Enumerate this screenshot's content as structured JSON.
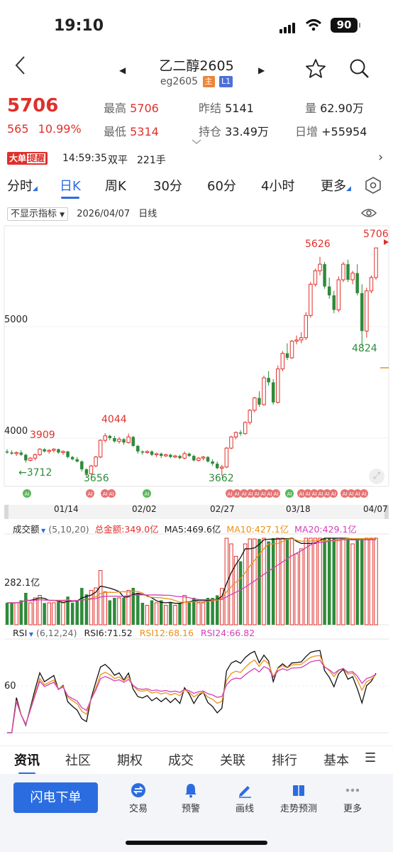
{
  "status": {
    "time": "19:10",
    "battery": "90"
  },
  "header": {
    "title": "乙二醇2605",
    "code": "eg2605",
    "badge_main": "主",
    "badge_l1": "L1"
  },
  "quote": {
    "last": "5706",
    "change": "565",
    "change_pct": "10.99%",
    "high_label": "最高",
    "high": "5706",
    "low_label": "最低",
    "low": "5314",
    "prev_settle_label": "昨结",
    "prev_settle": "5141",
    "open_interest_label": "持仓",
    "open_interest": "33.49万",
    "volume_label": "量",
    "volume": "62.90万",
    "daily_inc_label": "日增",
    "daily_inc": "+55954"
  },
  "banner": {
    "tag_a": "大单",
    "tag_b": "提醒",
    "time": "14:59:35",
    "type": "双平",
    "qty": "221手",
    "arrow": "›"
  },
  "tabs": [
    "分时",
    "日K",
    "周K",
    "30分",
    "60分",
    "4小时",
    "更多"
  ],
  "indicator_row": {
    "dropdown": "不显示指标",
    "date": "2026/04/07",
    "period": "日线"
  },
  "main_chart": {
    "y_labels": [
      "5000",
      "4000"
    ],
    "x_labels": [
      "01/14",
      "02/02",
      "02/27",
      "03/18",
      "04/07"
    ],
    "annotations": [
      "5706",
      "5626",
      "4824",
      "4044",
      "3909",
      "←3712",
      "3656",
      "3662"
    ],
    "ai_badge": "AI"
  },
  "volume_panel": {
    "dropdown": "成交额",
    "params": "(5,10,20)",
    "total": "总金额:349.0亿",
    "ma5": "MA5:469.6亿",
    "ma10": "MA10:427.1亿",
    "ma20": "MA20:429.1亿",
    "y_label": "282.1亿"
  },
  "rsi_panel": {
    "dropdown": "RSI",
    "params": "(6,12,24)",
    "rsi6": "RSI6:71.52",
    "rsi12": "RSI12:68.16",
    "rsi24": "RSI24:66.82",
    "y_label": "60"
  },
  "bottom_tabs": [
    "资讯",
    "社区",
    "期权",
    "成交",
    "关联",
    "排行",
    "基本",
    "☰"
  ],
  "actions": {
    "flash": "闪电下单",
    "items": [
      "交易",
      "预警",
      "画线",
      "走势预测",
      "更多"
    ]
  },
  "chart_data": {
    "type": "candlestick",
    "title": "",
    "x_ticks": [
      "01/14",
      "02/02",
      "02/27",
      "03/18",
      "04/07"
    ],
    "y_ticks": [
      4000,
      5000
    ],
    "candles_ohlc": [
      [
        3880,
        3900,
        3860,
        3870
      ],
      [
        3870,
        3890,
        3850,
        3860
      ],
      [
        3860,
        3880,
        3840,
        3870
      ],
      [
        3870,
        3890,
        3840,
        3850
      ],
      [
        3850,
        3860,
        3780,
        3800
      ],
      [
        3800,
        3830,
        3790,
        3820
      ],
      [
        3820,
        3860,
        3800,
        3850
      ],
      [
        3850,
        3910,
        3840,
        3900
      ],
      [
        3900,
        3909,
        3870,
        3880
      ],
      [
        3880,
        3900,
        3860,
        3890
      ],
      [
        3890,
        3910,
        3870,
        3900
      ],
      [
        3900,
        3905,
        3860,
        3870
      ],
      [
        3870,
        3890,
        3850,
        3880
      ],
      [
        3880,
        3885,
        3820,
        3830
      ],
      [
        3830,
        3840,
        3800,
        3810
      ],
      [
        3810,
        3830,
        3780,
        3790
      ],
      [
        3790,
        3800,
        3700,
        3720
      ],
      [
        3720,
        3730,
        3656,
        3680
      ],
      [
        3680,
        3760,
        3670,
        3750
      ],
      [
        3750,
        3840,
        3740,
        3830
      ],
      [
        3830,
        3990,
        3820,
        3980
      ],
      [
        3980,
        4044,
        3960,
        4020
      ],
      [
        4020,
        4030,
        3980,
        4000
      ],
      [
        4000,
        4020,
        3960,
        3970
      ],
      [
        3970,
        4010,
        3950,
        3990
      ],
      [
        3990,
        4000,
        3940,
        3960
      ],
      [
        3960,
        4040,
        3950,
        4010
      ],
      [
        4010,
        4020,
        3920,
        3930
      ],
      [
        3930,
        3940,
        3860,
        3880
      ],
      [
        3880,
        3890,
        3850,
        3870
      ],
      [
        3870,
        3890,
        3860,
        3880
      ],
      [
        3880,
        3890,
        3840,
        3850
      ],
      [
        3850,
        3870,
        3830,
        3860
      ],
      [
        3860,
        3870,
        3820,
        3840
      ],
      [
        3840,
        3860,
        3830,
        3850
      ],
      [
        3850,
        3860,
        3820,
        3830
      ],
      [
        3830,
        3850,
        3820,
        3840
      ],
      [
        3840,
        3850,
        3810,
        3820
      ],
      [
        3820,
        3880,
        3810,
        3860
      ],
      [
        3860,
        3870,
        3830,
        3840
      ],
      [
        3840,
        3850,
        3790,
        3800
      ],
      [
        3800,
        3830,
        3790,
        3820
      ],
      [
        3820,
        3840,
        3800,
        3830
      ],
      [
        3830,
        3840,
        3780,
        3790
      ],
      [
        3790,
        3810,
        3750,
        3770
      ],
      [
        3770,
        3790,
        3720,
        3730
      ],
      [
        3730,
        3760,
        3662,
        3740
      ],
      [
        3740,
        3920,
        3730,
        3910
      ],
      [
        3910,
        4020,
        3900,
        4010
      ],
      [
        4010,
        4060,
        3990,
        4050
      ],
      [
        4050,
        4070,
        4020,
        4040
      ],
      [
        4040,
        4150,
        4030,
        4140
      ],
      [
        4140,
        4260,
        4120,
        4250
      ],
      [
        4250,
        4370,
        4230,
        4360
      ],
      [
        4360,
        4420,
        4280,
        4300
      ],
      [
        4300,
        4560,
        4290,
        4540
      ],
      [
        4540,
        4600,
        4470,
        4500
      ],
      [
        4500,
        4530,
        4300,
        4320
      ],
      [
        4320,
        4650,
        4310,
        4620
      ],
      [
        4620,
        4780,
        4600,
        4760
      ],
      [
        4760,
        4850,
        4700,
        4720
      ],
      [
        4720,
        4880,
        4710,
        4870
      ],
      [
        4870,
        4920,
        4840,
        4880
      ],
      [
        4880,
        4950,
        4850,
        4900
      ],
      [
        4900,
        5130,
        4880,
        5100
      ],
      [
        5100,
        5400,
        5080,
        5380
      ],
      [
        5380,
        5520,
        5360,
        5500
      ],
      [
        5500,
        5626,
        5460,
        5560
      ],
      [
        5560,
        5580,
        5340,
        5360
      ],
      [
        5360,
        5440,
        5250,
        5280
      ],
      [
        5280,
        5320,
        5120,
        5150
      ],
      [
        5150,
        5450,
        5130,
        5420
      ],
      [
        5420,
        5580,
        5400,
        5560
      ],
      [
        5560,
        5600,
        5400,
        5420
      ],
      [
        5420,
        5500,
        5380,
        5480
      ],
      [
        5480,
        5560,
        5280,
        5300
      ],
      [
        5300,
        5380,
        4824,
        4960
      ],
      [
        4960,
        5350,
        4900,
        5320
      ],
      [
        5320,
        5460,
        5300,
        5440
      ],
      [
        5440,
        5706,
        5420,
        5706
      ]
    ]
  }
}
